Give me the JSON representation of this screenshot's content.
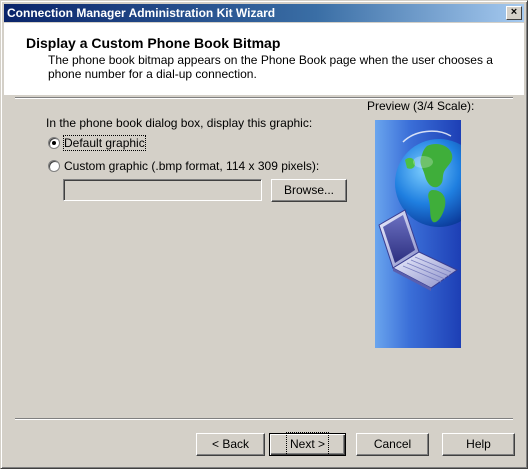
{
  "window": {
    "title": "Connection Manager Administration Kit Wizard",
    "close_symbol": "×"
  },
  "header": {
    "title": "Display a Custom Phone Book Bitmap",
    "description": "The phone book bitmap appears on the Phone Book page when the user chooses a phone number for a dial-up connection."
  },
  "content": {
    "prompt": "In the phone book dialog box, display this graphic:",
    "preview_label": "Preview (3/4 Scale):",
    "preview_image": "globe-and-laptop-icon",
    "options": [
      {
        "label": "Default graphic",
        "selected": true
      },
      {
        "label": "Custom graphic (.bmp format, 114 x 309 pixels):",
        "selected": false
      }
    ],
    "path_value": "",
    "browse_label": "Browse..."
  },
  "buttons": {
    "back": "< Back",
    "next": "Next >",
    "cancel": "Cancel",
    "help": "Help"
  },
  "colors": {
    "title_gradient_start": "#0a246a",
    "title_gradient_end": "#a6caf0",
    "face": "#d4d0c8",
    "preview_blue": "#3b6fd8"
  }
}
